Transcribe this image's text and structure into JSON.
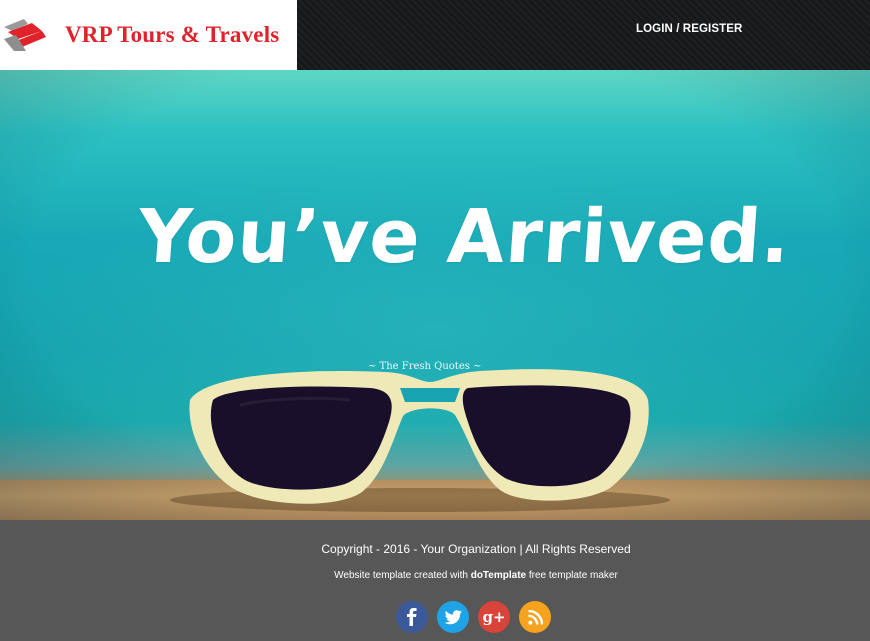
{
  "header": {
    "brand_name": "VRP Tours & Travels",
    "logo_icon": "vrp-arrow-logo",
    "nav_link": "LOGIN / REGISTER"
  },
  "hero": {
    "headline": "You’ve Arrived.",
    "watermark": "~ The Fresh Quotes ~"
  },
  "footer": {
    "copyright": "Copyright - 2016 - Your Organization | All Rights Reserved",
    "credit_prefix": "Website template created with ",
    "credit_brand": "doTemplate",
    "credit_suffix": " free template maker",
    "social": [
      {
        "name": "facebook",
        "icon": "facebook-icon",
        "color": "#3b5998"
      },
      {
        "name": "twitter",
        "icon": "twitter-icon",
        "color": "#1ea3e6"
      },
      {
        "name": "google-plus",
        "icon": "google-plus-icon",
        "label": "g+",
        "color": "#d9443a"
      },
      {
        "name": "rss",
        "icon": "rss-icon",
        "color": "#f5a21f"
      }
    ]
  },
  "colors": {
    "brand_red": "#e0232a",
    "nav_bg": "#16181a",
    "footer_bg": "#575757",
    "sky_teal": "#18a8b6"
  }
}
